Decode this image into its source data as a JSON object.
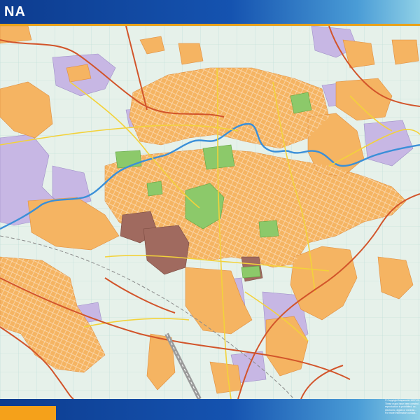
{
  "map": {
    "title": "NA",
    "colors": {
      "header": "#1553b0",
      "accent": "#f5a11a",
      "urban": "#f5b462",
      "industrial": "#c7b7e4",
      "park": "#8cc96a",
      "historic": "#a06a5f",
      "river": "#3a8fd8",
      "road_primary": "#d2542a",
      "road_secondary": "#f3d23a",
      "background": "#e6f1ea"
    }
  },
  "footer": {
    "copyright_lines": [
      "© Copyright Mapsworld 1997-20...",
      "These maps have been created ...",
      "reproduction is prohibited, ac...",
      "electronic, digital or mechan...",
      "For more information contact..."
    ]
  }
}
